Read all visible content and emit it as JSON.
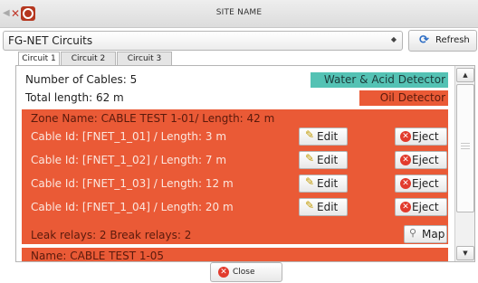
{
  "window": {
    "title": "SITE NAME"
  },
  "source": {
    "selected": "FG-NET Circuits"
  },
  "refresh_label": "Refresh",
  "tabs": [
    {
      "label": "Circuit 1"
    },
    {
      "label": "Circuit 2"
    },
    {
      "label": "Circuit 3"
    }
  ],
  "summary": {
    "cables": "Number of Cables: 5",
    "length": "Total length: 62 m"
  },
  "detectors": {
    "water": "Water & Acid Detector",
    "oil": "Oil Detector"
  },
  "zone": {
    "title": "Zone Name: CABLE TEST 1-01/ Length: 42 m",
    "cables": [
      {
        "label": "Cable Id: [FNET_1_01] / Length: 3 m",
        "edit": "Edit",
        "eject": "Eject"
      },
      {
        "label": "Cable Id: [FNET_1_02] / Length: 7 m",
        "edit": "Edit",
        "eject": "Eject"
      },
      {
        "label": "Cable Id: [FNET_1_03] / Length: 12 m",
        "edit": "Edit",
        "eject": "Eject"
      },
      {
        "label": "Cable Id: [FNET_1_04] / Length: 20 m",
        "edit": "Edit",
        "eject": "Eject"
      }
    ],
    "relays": "Leak relays: 2  Break relays: 2",
    "map_label": "Map"
  },
  "next_zone": {
    "title": "Name: CABLE TEST 1-05"
  },
  "close_label": "Close",
  "colors": {
    "water": "#54c2b4",
    "oil": "#ea5a36",
    "zone": "#ea5a36"
  },
  "icons": {
    "edit": "pencil-icon",
    "eject": "eject-x-icon",
    "map": "magnifier-icon",
    "refresh": "refresh-icon",
    "close": "close-x-icon",
    "app": "app-logo-icon"
  }
}
